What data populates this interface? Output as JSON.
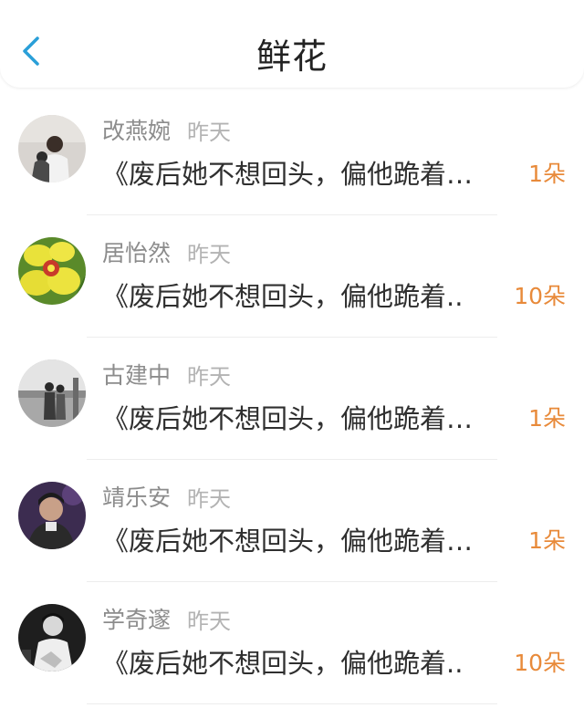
{
  "header": {
    "title": "鲜花",
    "back_icon": "chevron-left-icon",
    "accent": "#2a9fd8"
  },
  "items": [
    {
      "name": "改燕婉",
      "time": "昨天",
      "message": "《废后她不想回头，偏他跪着…",
      "count": "1朵",
      "avatar": "photo-person-icon",
      "avatar_bg": "#d8d4d0"
    },
    {
      "name": "居怡然",
      "time": "昨天",
      "message": "《废后她不想回头，偏他跪着..",
      "count": "10朵",
      "avatar": "yellow-orchid-flower-icon",
      "avatar_bg": "#e8df40"
    },
    {
      "name": "古建中",
      "time": "昨天",
      "message": "《废后她不想回头，偏他跪着…",
      "count": "1朵",
      "avatar": "bw-photo-couple-icon",
      "avatar_bg": "#9a9a9a"
    },
    {
      "name": "靖乐安",
      "time": "昨天",
      "message": "《废后她不想回头，偏他跪着…",
      "count": "1朵",
      "avatar": "photo-person-purple-icon",
      "avatar_bg": "#3c2c50"
    },
    {
      "name": "学奇邃",
      "time": "昨天",
      "message": "《废后她不想回头，偏他跪着..",
      "count": "10朵",
      "avatar": "bw-photo-person-icon",
      "avatar_bg": "#222222"
    }
  ],
  "colors": {
    "name": "#8c8c8c",
    "time": "#b3b3b3",
    "message": "#2f2f2f",
    "count": "#e88a3a"
  }
}
